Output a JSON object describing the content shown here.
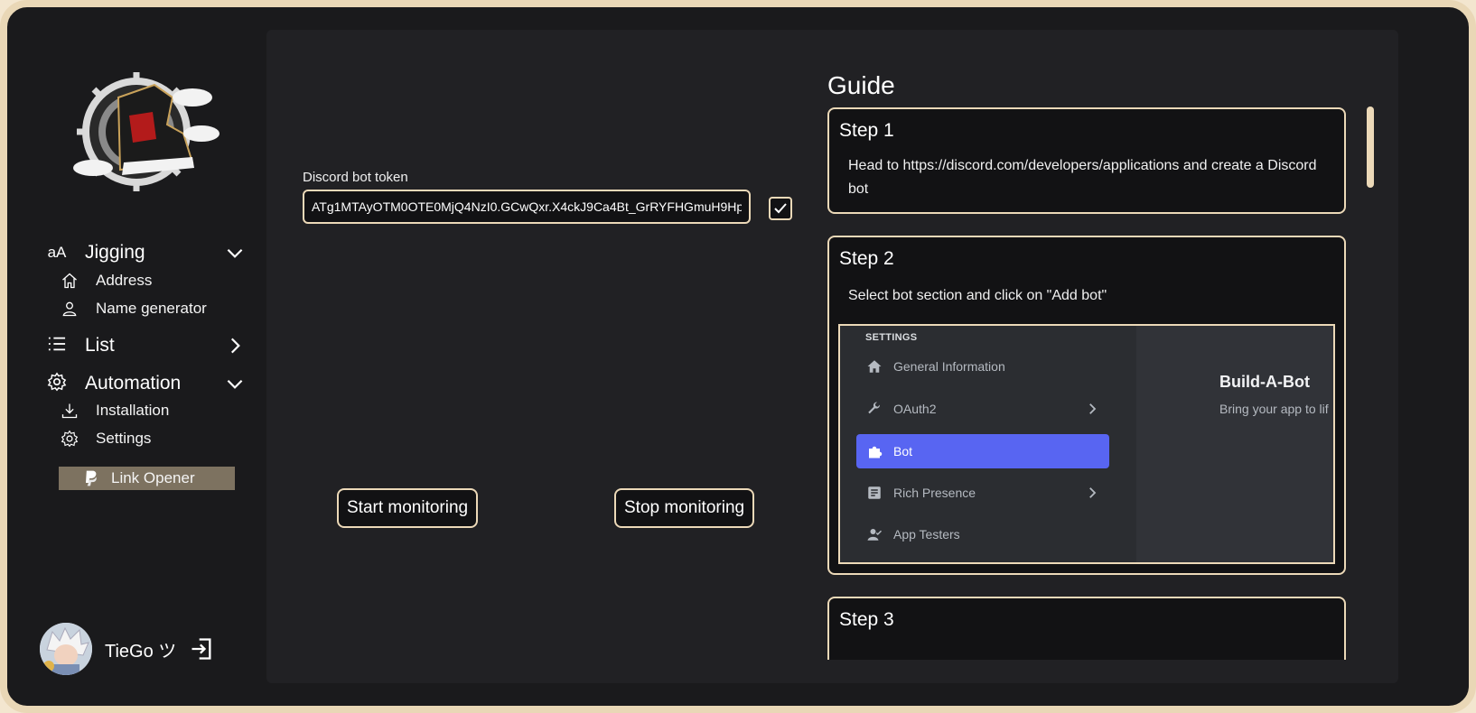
{
  "sidebar": {
    "groups": [
      {
        "label": "Jigging",
        "icon": "font-icon",
        "expanded": true,
        "items": [
          {
            "label": "Address",
            "icon": "home-icon"
          },
          {
            "label": "Name generator",
            "icon": "user-icon"
          }
        ]
      },
      {
        "label": "List",
        "icon": "list-icon",
        "expanded": false,
        "items": []
      },
      {
        "label": "Automation",
        "icon": "gear-icon",
        "expanded": true,
        "items": [
          {
            "label": "Installation",
            "icon": "download-icon"
          },
          {
            "label": "Settings",
            "icon": "settings-icon"
          },
          {
            "label": "Link Opener",
            "icon": "paypal-icon",
            "active": true
          }
        ]
      }
    ],
    "user": {
      "name": "TieGo ツ"
    }
  },
  "main": {
    "token_label": "Discord bot token",
    "token_value": "ATg1MTAyOTM0OTE0MjQ4NzI0.GCwQxr.X4ckJ9Ca4Bt_GrRYFHGmuH9Hp",
    "start_label": "Start monitoring",
    "stop_label": "Stop monitoring"
  },
  "guide": {
    "title": "Guide",
    "steps": [
      {
        "title": "Step 1",
        "text": "Head to https://discord.com/developers/applications and create a Discord bot"
      },
      {
        "title": "Step 2",
        "text": "Select bot section and click on \"Add bot\"",
        "image": {
          "heading": "SETTINGS",
          "items": [
            {
              "label": "General Information",
              "icon": "home-icon"
            },
            {
              "label": "OAuth2",
              "icon": "wrench-icon",
              "chevron": true
            },
            {
              "label": "Bot",
              "icon": "puzzle-icon",
              "selected": true
            },
            {
              "label": "Rich Presence",
              "icon": "document-icon",
              "chevron": true
            },
            {
              "label": "App Testers",
              "icon": "user-check-icon"
            }
          ],
          "title": "Build-A-Bot",
          "subtitle": "Bring your app to lif"
        }
      },
      {
        "title": "Step 3",
        "text": ""
      }
    ]
  },
  "colors": {
    "accent": "#ecd9b8",
    "frame": "#e9d7b6",
    "panel": "#212124",
    "active_item": "#7d7260",
    "discord_blurple": "#5865f2"
  }
}
